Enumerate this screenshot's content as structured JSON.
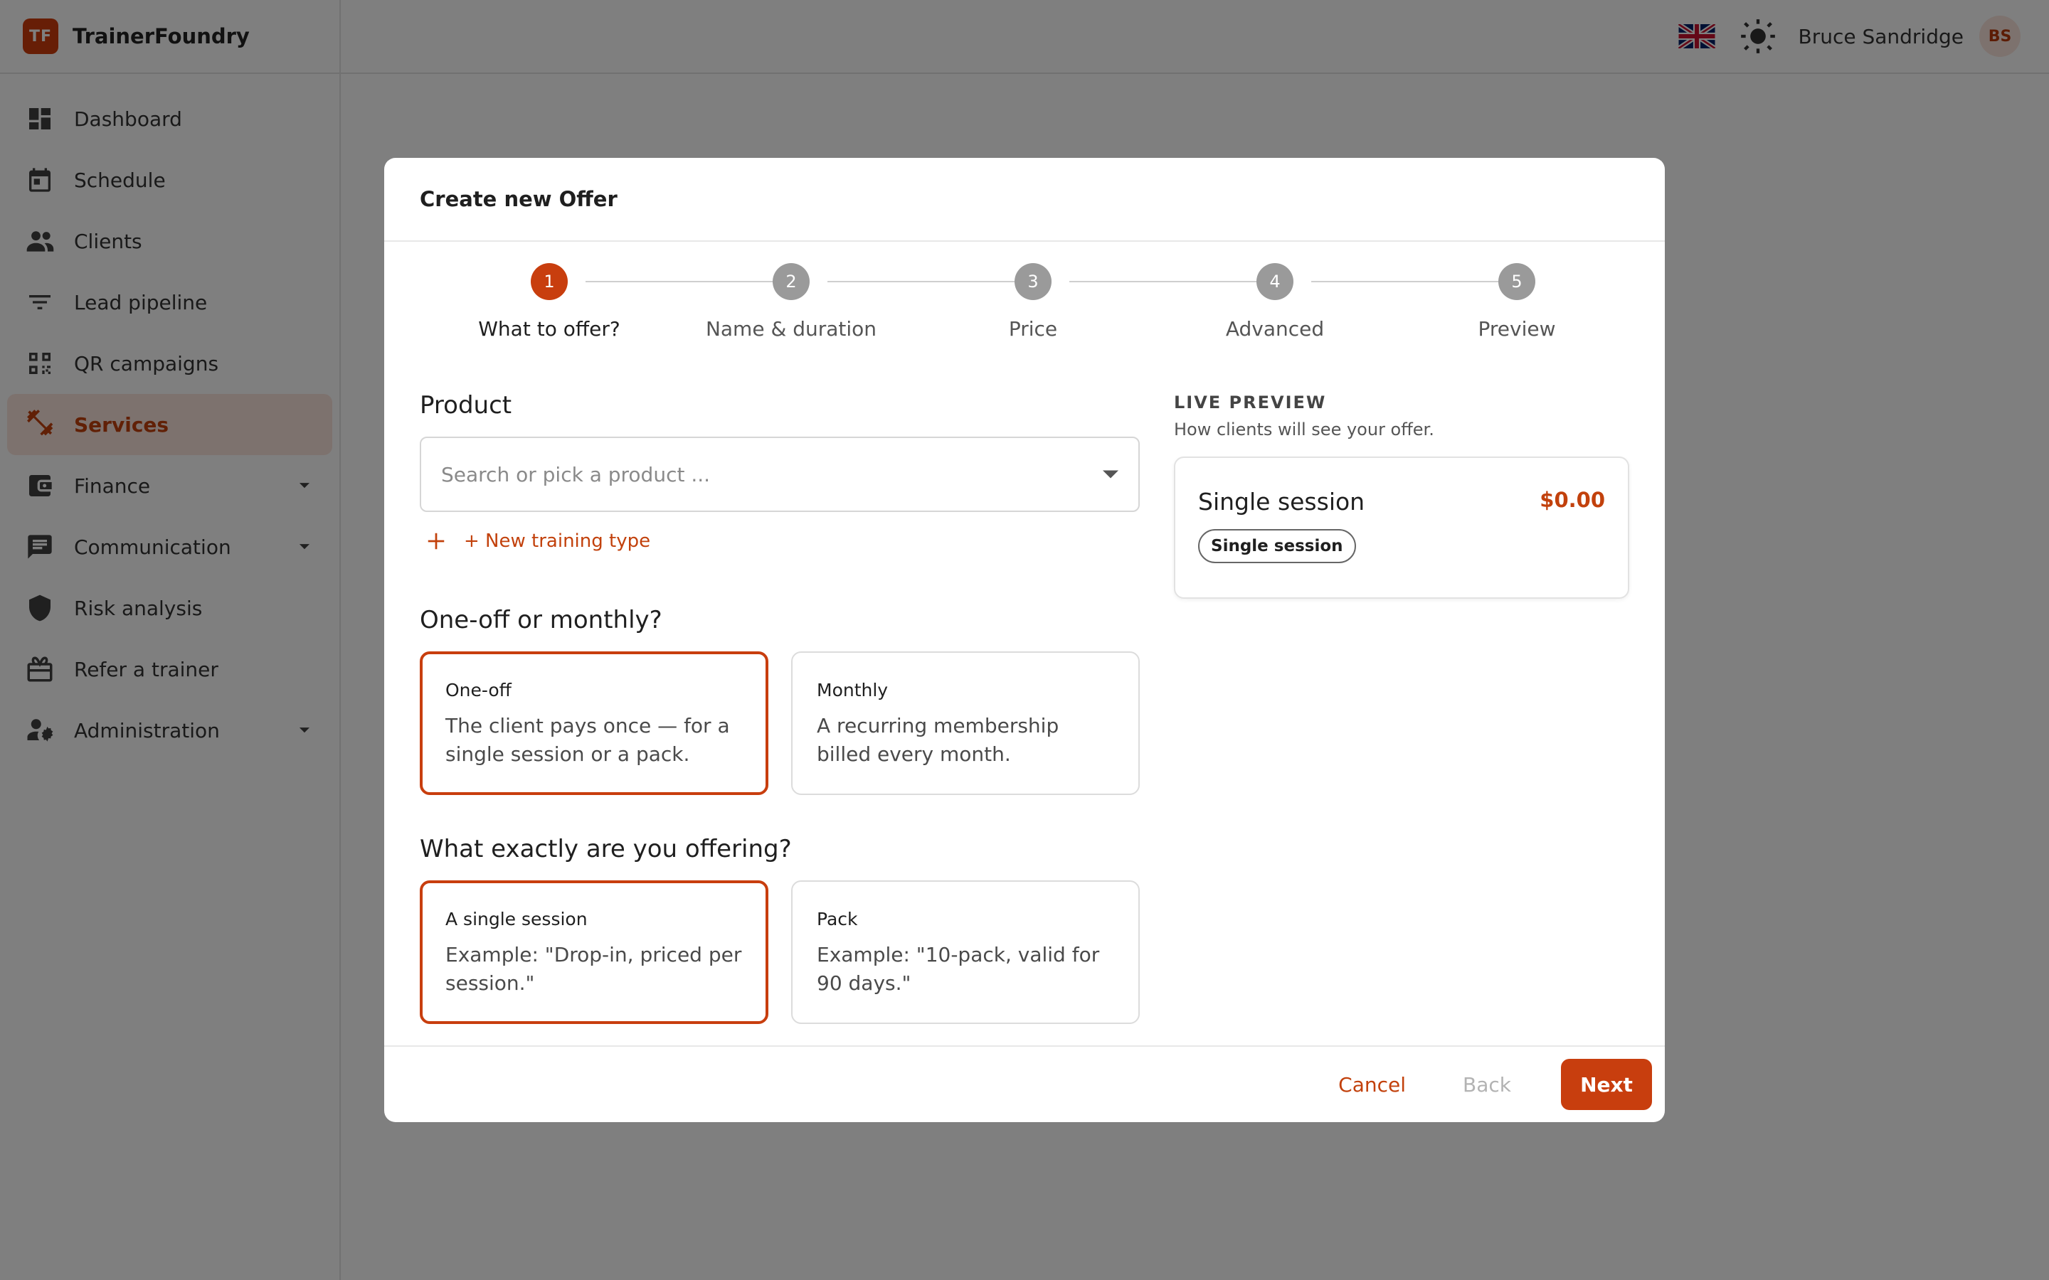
{
  "app": {
    "brand_initials": "TF",
    "brand_name": "TrainerFoundry",
    "accent_color": "#c83e0e"
  },
  "sidebar": {
    "items": [
      {
        "label": "Dashboard",
        "icon": "dashboard-icon"
      },
      {
        "label": "Schedule",
        "icon": "calendar-icon"
      },
      {
        "label": "Clients",
        "icon": "people-icon"
      },
      {
        "label": "Lead pipeline",
        "icon": "filter-icon"
      },
      {
        "label": "QR campaigns",
        "icon": "qr-code-icon"
      },
      {
        "label": "Services",
        "icon": "dumbbell-icon",
        "active": true
      },
      {
        "label": "Finance",
        "icon": "wallet-icon",
        "expandable": true
      },
      {
        "label": "Communication",
        "icon": "chat-icon",
        "expandable": true
      },
      {
        "label": "Risk analysis",
        "icon": "shield-icon"
      },
      {
        "label": "Refer a trainer",
        "icon": "gift-icon"
      },
      {
        "label": "Administration",
        "icon": "user-gear-icon",
        "expandable": true
      }
    ]
  },
  "topbar": {
    "language_icon": "uk-flag-icon",
    "theme_icon": "sun-icon",
    "user_name": "Bruce Sandridge",
    "user_initials": "BS"
  },
  "modal": {
    "title": "Create new Offer",
    "steps": [
      {
        "number": "1",
        "label": "What to offer?",
        "active": true
      },
      {
        "number": "2",
        "label": "Name & duration"
      },
      {
        "number": "3",
        "label": "Price"
      },
      {
        "number": "4",
        "label": "Advanced"
      },
      {
        "number": "5",
        "label": "Preview"
      }
    ],
    "product": {
      "title": "Product",
      "placeholder": "Search or pick a product ...",
      "new_type_label": "+ New training type"
    },
    "billing": {
      "title": "One-off or monthly?",
      "options": [
        {
          "title": "One-off",
          "description": "The client pays once — for a single session or a pack.",
          "selected": true
        },
        {
          "title": "Monthly",
          "description": "A recurring membership billed every month."
        }
      ]
    },
    "offering": {
      "title": "What exactly are you offering?",
      "options": [
        {
          "title": "A single session",
          "description": "Example: \"Drop-in, priced per session.\"",
          "selected": true
        },
        {
          "title": "Pack",
          "description": "Example: \"10-pack, valid for 90 days.\""
        }
      ]
    },
    "preview": {
      "label": "LIVE PREVIEW",
      "subtitle": "How clients will see your offer.",
      "card_title": "Single session",
      "card_price": "$0.00",
      "card_chip": "Single session"
    },
    "footer": {
      "cancel_label": "Cancel",
      "back_label": "Back",
      "next_label": "Next"
    }
  }
}
